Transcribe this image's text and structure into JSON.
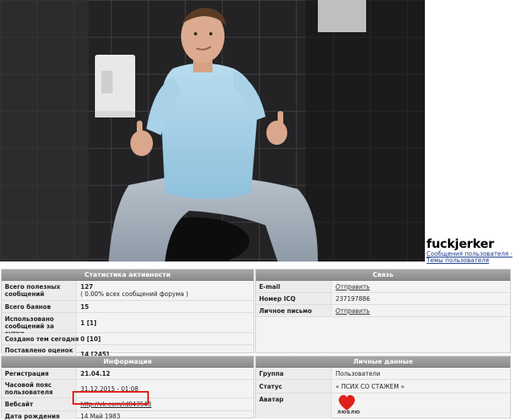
{
  "profile": {
    "username": "fuckjerker",
    "link_posts": "Сообщения пользователя",
    "link_sep": "·",
    "link_topics": "Темы пользователя"
  },
  "stats": {
    "header": "Статистика активности",
    "rows": [
      {
        "label": "Всего полезных сообщений",
        "value": "127",
        "sub": "( 0.00% всех сообщений форума )"
      },
      {
        "label": "Всего баянов",
        "value": "15"
      },
      {
        "label": "Использовано сообщений за сутки",
        "value": "1 [1]"
      },
      {
        "label": "Создано тем сегодня",
        "value": "0 [10]"
      },
      {
        "label": "Поставлено оценок сегодня",
        "value": "14 [245]"
      }
    ]
  },
  "contact": {
    "header": "Связь",
    "rows": [
      {
        "label": "E-mail",
        "value": "Отправить"
      },
      {
        "label": "Номер ICQ",
        "value": "237197886"
      },
      {
        "label": "Личное письмо",
        "value": "Отправить"
      }
    ]
  },
  "info": {
    "header": "Информация",
    "rows": [
      {
        "label": "Регистрация",
        "value": "21.04.12"
      },
      {
        "label": "Часовой пояс пользователя",
        "value": "31.12.2015 - 01:08"
      },
      {
        "label": "Вебсайт",
        "value": "http://vk.com/id843543"
      },
      {
        "label": "Дата рождения",
        "value": "14 Май 1983"
      }
    ]
  },
  "personal": {
    "header": "Личные данные",
    "rows": [
      {
        "label": "Группа",
        "value": "Пользователи"
      },
      {
        "label": "Статус",
        "value": "« ПСИХ СО СТАЖЕМ »"
      },
      {
        "label": "Аватар",
        "value": ""
      }
    ],
    "avatar_text": "ЛЮБЛЮ"
  },
  "colors": {
    "highlight": "#e0201a",
    "header_bg": "#999999",
    "link": "#1a3a8a"
  }
}
